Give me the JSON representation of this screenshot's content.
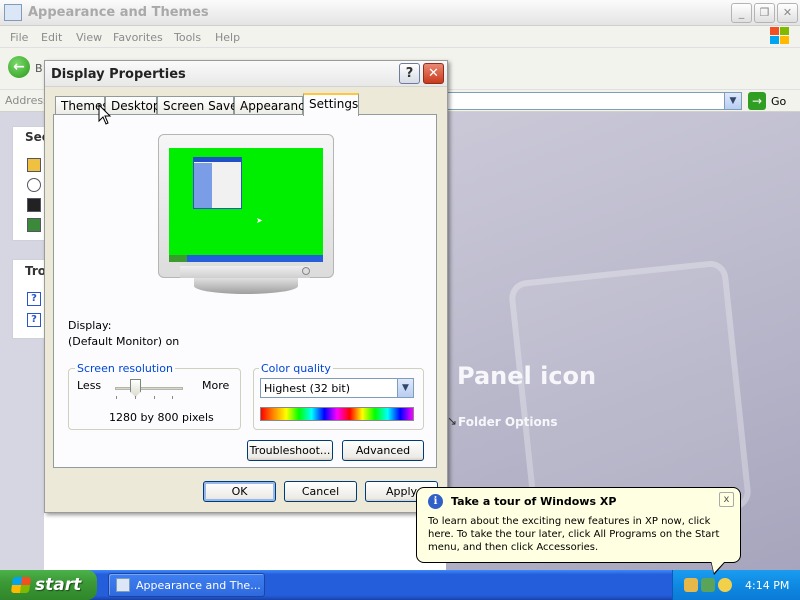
{
  "explorer": {
    "title": "Appearance and Themes",
    "menu": [
      "File",
      "Edit",
      "View",
      "Favorites",
      "Tools",
      "Help"
    ],
    "back_label": "B",
    "address_label": "Address",
    "go_label": "Go",
    "side_heading_1": "See",
    "side_heading_2": "Tro",
    "content_heading": "Panel icon",
    "folder_options": "Folder Options"
  },
  "dialog": {
    "title": "Display Properties",
    "help_label": "?",
    "close_label": "✕",
    "tabs": [
      "Themes",
      "Desktop",
      "Screen Saver",
      "Appearance",
      "Settings"
    ],
    "active_tab": "Settings",
    "display_label": "Display:",
    "display_value": "(Default Monitor) on",
    "resolution": {
      "group_label": "Screen resolution",
      "less": "Less",
      "more": "More",
      "value": "1280 by 800 pixels"
    },
    "color_quality": {
      "group_label": "Color quality",
      "selected": "Highest (32 bit)"
    },
    "buttons": {
      "troubleshoot": "Troubleshoot...",
      "advanced": "Advanced",
      "ok": "OK",
      "cancel": "Cancel",
      "apply": "Apply"
    }
  },
  "balloon": {
    "title": "Take a tour of Windows XP",
    "close_label": "x",
    "body": "To learn about the exciting new features in XP now, click here. To take the tour later, click All Programs on the Start menu, and then click Accessories."
  },
  "taskbar": {
    "start_label": "start",
    "task_label": "Appearance and The...",
    "clock": "4:14 PM"
  },
  "icons": {
    "start": "windows-logo-icon",
    "info": "info-icon",
    "back": "back-arrow-icon",
    "go": "go-arrow-icon"
  }
}
